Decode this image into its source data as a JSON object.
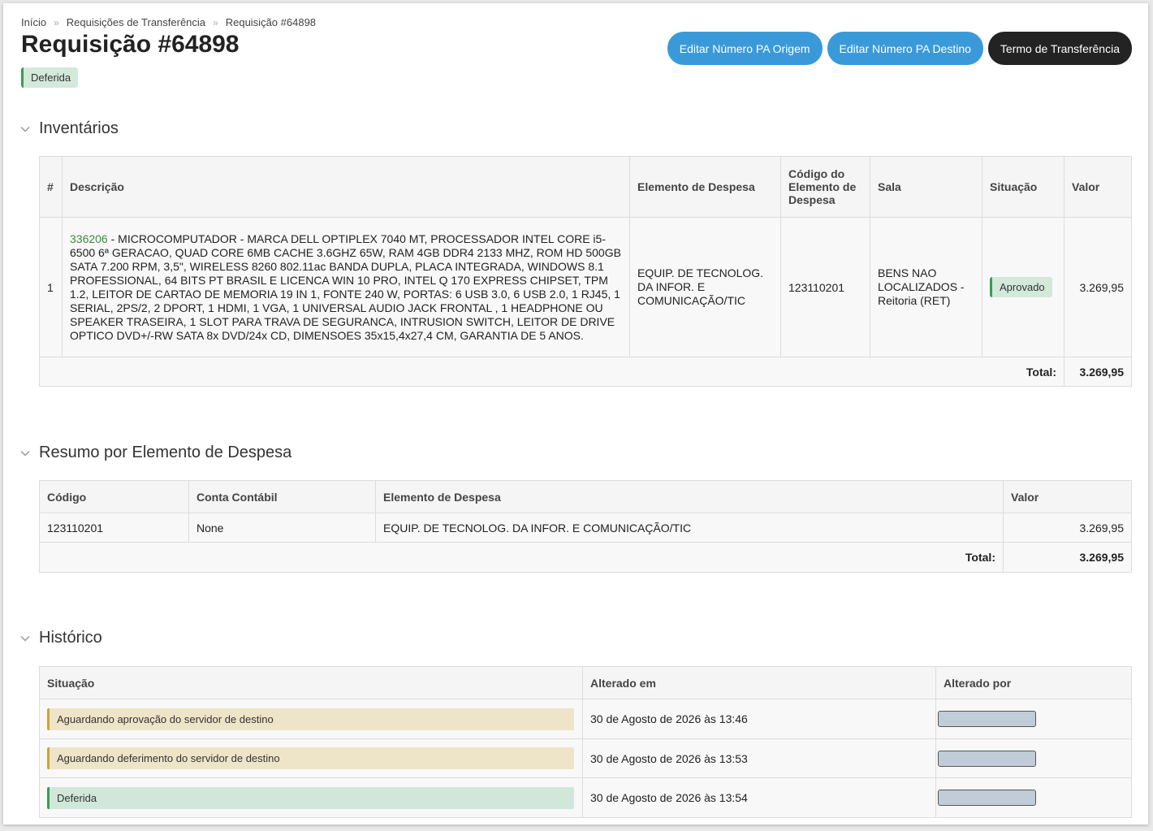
{
  "breadcrumb": [
    "Início",
    "Requisições de Transferência",
    "Requisição #64898"
  ],
  "page_title": "Requisição #64898",
  "status_badge": "Deferida",
  "actions": {
    "edit_origin": "Editar Número PA Origem",
    "edit_dest": "Editar Número PA Destino",
    "term": "Termo de Transferência"
  },
  "inventarios": {
    "title": "Inventários",
    "headers": [
      "#",
      "Descrição",
      "Elemento de Despesa",
      "Código do Elemento de Despesa",
      "Sala",
      "Situação",
      "Valor"
    ],
    "row": {
      "index": "1",
      "code": "336206",
      "description": " - MICROCOMPUTADOR - MARCA DELL OPTIPLEX 7040 MT, PROCESSADOR INTEL CORE i5-6500 6ª GERACAO, QUAD CORE 6MB CACHE 3.6GHZ 65W, RAM 4GB DDR4 2133 MHZ, ROM HD 500GB SATA 7.200 RPM, 3,5\", WIRELESS 8260 802.11ac BANDA DUPLA, PLACA INTEGRADA, WINDOWS 8.1 PROFESSIONAL, 64 BITS PT BRASIL E LICENCA WIN 10 PRO, INTEL Q 170 EXPRESS CHIPSET, TPM 1.2, LEITOR DE CARTAO DE MEMORIA 19 IN 1, FONTE 240 W, PORTAS: 6 USB 3.0, 6 USB 2.0, 1 RJ45, 1 SERIAL, 2PS/2, 2 DPORT, 1 HDMI, 1 VGA, 1 UNIVERSAL AUDIO JACK FRONTAL , 1 HEADPHONE OU SPEAKER TRASEIRA, 1 SLOT PARA TRAVA DE SEGURANCA, INTRUSION SWITCH, LEITOR DE DRIVE OPTICO DVD+/-RW SATA 8x DVD/24x CD, DIMENSOES 35x15,4x27,4 CM, GARANTIA DE 5 ANOS.",
      "elemento": "EQUIP. DE TECNOLOG. DA INFOR. E COMUNICAÇÃO/TIC",
      "codigo_elemento": "123110201",
      "sala": "BENS NAO LOCALIZADOS - Reitoria (RET)",
      "situacao": "Aprovado",
      "valor": "3.269,95"
    },
    "total_label": "Total:",
    "total_value": "3.269,95"
  },
  "resumo": {
    "title": "Resumo por Elemento de Despesa",
    "headers": [
      "Código",
      "Conta Contábil",
      "Elemento de Despesa",
      "Valor"
    ],
    "row": {
      "codigo": "123110201",
      "conta": "None",
      "elemento": "EQUIP. DE TECNOLOG. DA INFOR. E COMUNICAÇÃO/TIC",
      "valor": "3.269,95"
    },
    "total_label": "Total:",
    "total_value": "3.269,95"
  },
  "historico": {
    "title": "Histórico",
    "headers": [
      "Situação",
      "Alterado em",
      "Alterado por"
    ],
    "rows": [
      {
        "situacao": "Aguardando aprovação do servidor de destino",
        "alterado_em": "30 de Agosto de 2026 às 13:46",
        "tone": "pending"
      },
      {
        "situacao": "Aguardando deferimento do servidor de destino",
        "alterado_em": "30 de Agosto de 2026 às 13:53",
        "tone": "pending"
      },
      {
        "situacao": "Deferida",
        "alterado_em": "30 de Agosto de 2026 às 13:54",
        "tone": "success"
      }
    ]
  },
  "colors": {
    "primary_button": "#3a9ad9",
    "dark_button": "#232323",
    "success_bg": "#d3e9da",
    "success_border": "#3b9a5a",
    "pending_bg": "#eee4c8",
    "pending_border": "#c9a43a",
    "link": "#3a8d3a"
  }
}
